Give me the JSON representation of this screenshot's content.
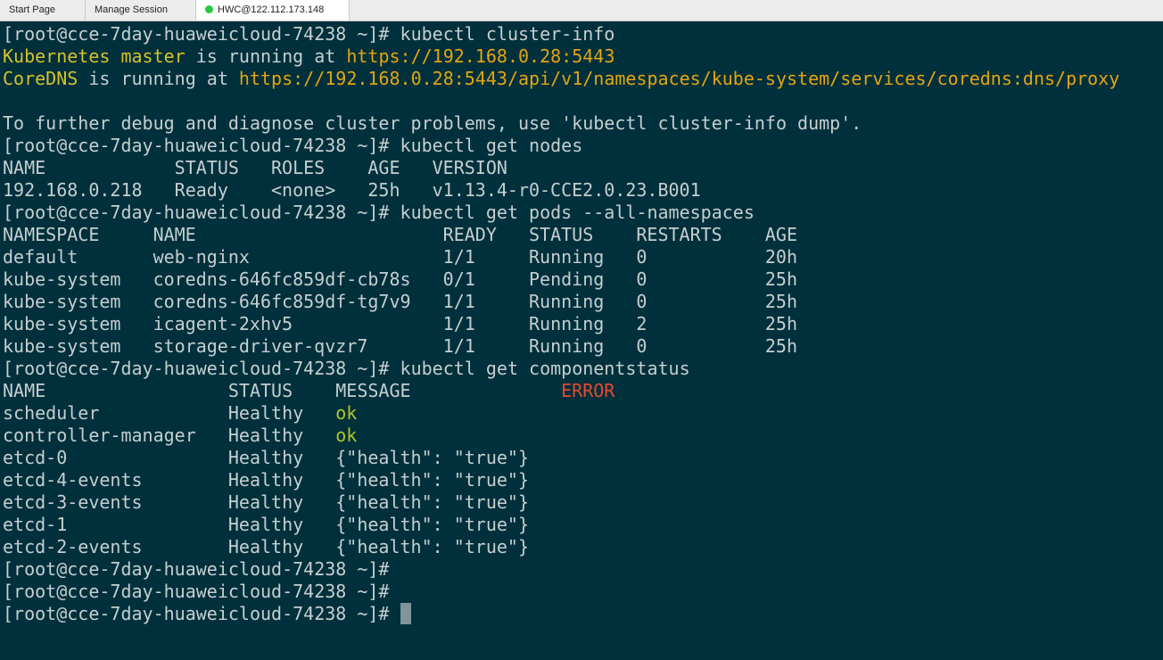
{
  "tabs": [
    {
      "label": "Start Page"
    },
    {
      "label": "Manage Session"
    },
    {
      "label": "HWC@122.112.173.148",
      "status_color": "#27c93f"
    }
  ],
  "colors": {
    "background": "#00303c",
    "text": "#c5ced0",
    "highlight_yellow": "#d6c22a",
    "url_orange": "#e3a413",
    "error_red": "#e5492f",
    "ok_green": "#b0c42a"
  },
  "terminal": {
    "prompt": "[root@cce-7day-huaweicloud-74238 ~]# ",
    "commands": {
      "cluster_info": "kubectl cluster-info",
      "get_nodes": "kubectl get nodes",
      "get_pods": "kubectl get pods --all-namespaces",
      "get_cs": "kubectl get componentstatus"
    },
    "cluster_info": {
      "master_label": "Kubernetes master",
      "master_mid": " is running at ",
      "master_url": "https://192.168.0.28:5443",
      "dns_label": "CoreDNS",
      "dns_mid": " is running at ",
      "dns_url": "https://192.168.0.28:5443/api/v1/namespaces/kube-system/services/coredns:dns/proxy",
      "hint": "To further debug and diagnose cluster problems, use 'kubectl cluster-info dump'."
    },
    "nodes": {
      "headers": [
        "NAME",
        "STATUS",
        "ROLES",
        "AGE",
        "VERSION"
      ],
      "rows": [
        [
          "192.168.0.218",
          "Ready",
          "<none>",
          "25h",
          "v1.13.4-r0-CCE2.0.23.B001"
        ]
      ]
    },
    "pods": {
      "headers": [
        "NAMESPACE",
        "NAME",
        "READY",
        "STATUS",
        "RESTARTS",
        "AGE"
      ],
      "rows": [
        [
          "default",
          "web-nginx",
          "1/1",
          "Running",
          "0",
          "20h"
        ],
        [
          "kube-system",
          "coredns-646fc859df-cb78s",
          "0/1",
          "Pending",
          "0",
          "25h"
        ],
        [
          "kube-system",
          "coredns-646fc859df-tg7v9",
          "1/1",
          "Running",
          "0",
          "25h"
        ],
        [
          "kube-system",
          "icagent-2xhv5",
          "1/1",
          "Running",
          "2",
          "25h"
        ],
        [
          "kube-system",
          "storage-driver-qvzr7",
          "1/1",
          "Running",
          "0",
          "25h"
        ]
      ]
    },
    "componentstatus": {
      "headers": [
        "NAME",
        "STATUS",
        "MESSAGE",
        "ERROR"
      ],
      "rows": [
        [
          "scheduler",
          "Healthy",
          "ok"
        ],
        [
          "controller-manager",
          "Healthy",
          "ok"
        ],
        [
          "etcd-0",
          "Healthy",
          "{\"health\": \"true\"}"
        ],
        [
          "etcd-4-events",
          "Healthy",
          "{\"health\": \"true\"}"
        ],
        [
          "etcd-3-events",
          "Healthy",
          "{\"health\": \"true\"}"
        ],
        [
          "etcd-1",
          "Healthy",
          "{\"health\": \"true\"}"
        ],
        [
          "etcd-2-events",
          "Healthy",
          "{\"health\": \"true\"}"
        ]
      ]
    }
  }
}
